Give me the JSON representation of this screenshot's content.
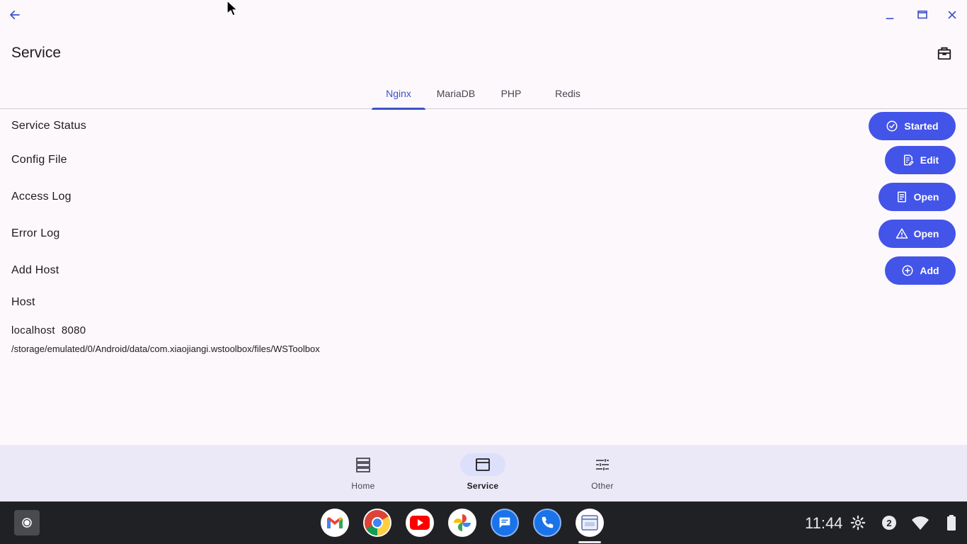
{
  "window": {
    "back_icon": "arrow-left-icon",
    "minimize_icon": "minimize-icon",
    "maximize_icon": "maximize-icon",
    "close_icon": "close-icon"
  },
  "appbar": {
    "title": "Service",
    "action_icon": "briefcase-icon"
  },
  "tabs": [
    {
      "label": "Nginx",
      "active": true
    },
    {
      "label": "MariaDB",
      "active": false
    },
    {
      "label": "PHP",
      "active": false
    },
    {
      "label": "Redis",
      "active": false
    }
  ],
  "rows": [
    {
      "label": "Service Status",
      "button": "Started",
      "icon": "check-circle-icon"
    },
    {
      "label": "Config File",
      "button": "Edit",
      "icon": "edit-document-icon"
    },
    {
      "label": "Access Log",
      "button": "Open",
      "icon": "document-icon"
    },
    {
      "label": "Error Log",
      "button": "Open",
      "icon": "warning-icon"
    },
    {
      "label": "Add Host",
      "button": "Add",
      "icon": "plus-circle-icon"
    }
  ],
  "host": {
    "heading": "Host",
    "name": "localhost",
    "port": "8080",
    "path": "/storage/emulated/0/Android/data/com.xiaojiangi.wstoolbox/files/WSToolbox"
  },
  "bottom_nav": [
    {
      "label": "Home",
      "icon": "server-icon",
      "active": false
    },
    {
      "label": "Service",
      "icon": "window-icon",
      "active": true
    },
    {
      "label": "Other",
      "icon": "sliders-icon",
      "active": false
    }
  ],
  "shelf": {
    "apps": [
      "gmail-icon",
      "chrome-icon",
      "youtube-icon",
      "photos-icon",
      "messages-icon",
      "phone-icon",
      "wstoolbox-icon"
    ],
    "clock": "11:44",
    "notification_count": "2"
  },
  "colors": {
    "accent": "#4354e8",
    "tab_active": "#3f51c9",
    "background": "#fdf8fc",
    "nav_bg": "#ebe9f7",
    "shelf_bg": "#202124"
  }
}
